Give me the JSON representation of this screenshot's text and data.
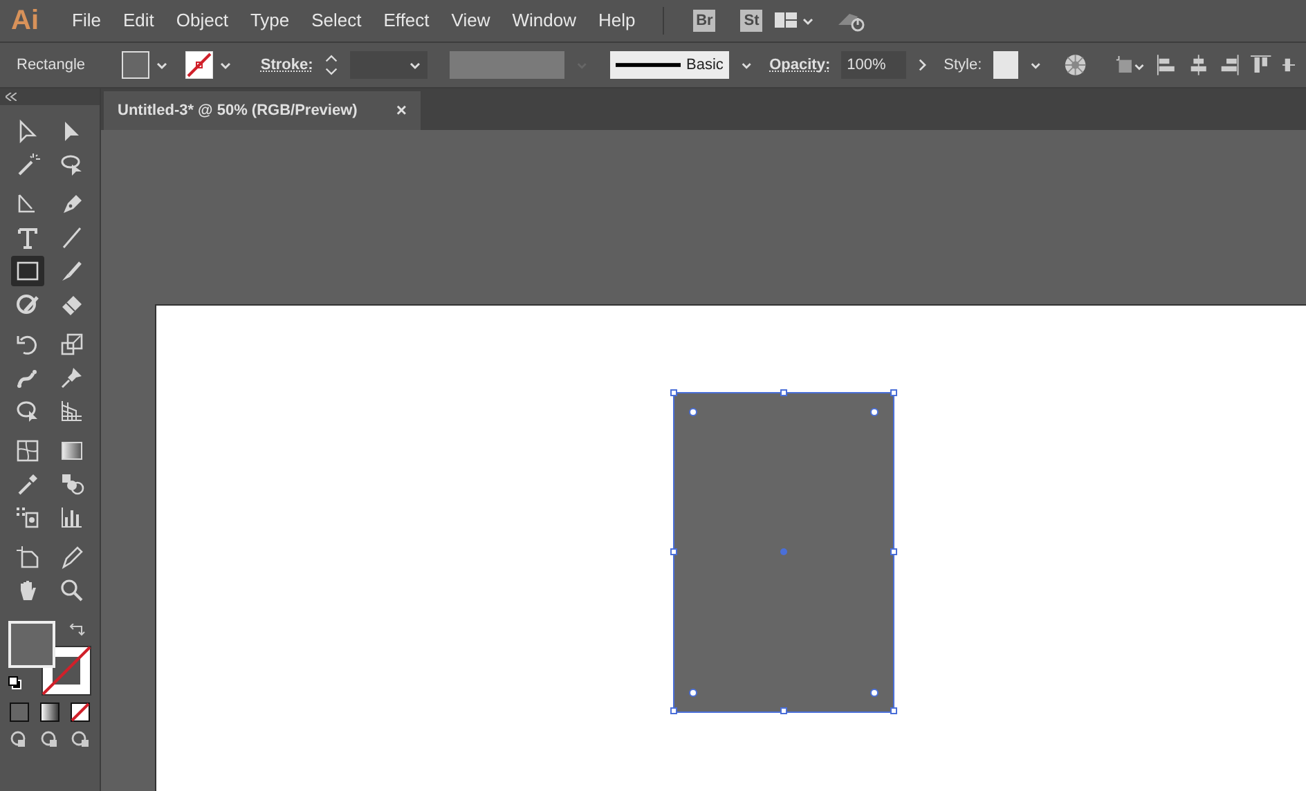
{
  "app": {
    "logo": "Ai"
  },
  "menu": [
    "File",
    "Edit",
    "Object",
    "Type",
    "Select",
    "Effect",
    "View",
    "Window",
    "Help"
  ],
  "app_buttons": [
    "Br",
    "St"
  ],
  "control_bar": {
    "tool_name": "Rectangle",
    "stroke_label": "Stroke:",
    "brush": "Basic",
    "opacity_label": "Opacity:",
    "opacity": "100%",
    "style_label": "Style:"
  },
  "document_tab": {
    "title": "Untitled-3* @ 50% (RGB/Preview)",
    "close": "×"
  },
  "tool_groups": [
    [
      {
        "kind": "selection",
        "selected": false
      },
      {
        "kind": "direct",
        "selected": false
      },
      {
        "kind": "wand",
        "selected": false
      },
      {
        "kind": "lasso",
        "selected": false
      }
    ],
    [
      {
        "kind": "curvature",
        "selected": false
      },
      {
        "kind": "pen",
        "selected": false
      },
      {
        "kind": "type",
        "selected": false
      },
      {
        "kind": "line",
        "selected": false
      },
      {
        "kind": "rectangle",
        "selected": true
      },
      {
        "kind": "brush",
        "selected": false
      },
      {
        "kind": "shaper",
        "selected": false
      },
      {
        "kind": "eraser",
        "selected": false
      }
    ],
    [
      {
        "kind": "rotate",
        "selected": false
      },
      {
        "kind": "scale",
        "selected": false
      },
      {
        "kind": "puppet",
        "selected": false
      },
      {
        "kind": "pin",
        "selected": false
      },
      {
        "kind": "shapebuilder",
        "selected": false
      },
      {
        "kind": "perspective",
        "selected": false
      }
    ],
    [
      {
        "kind": "mesh",
        "selected": false
      },
      {
        "kind": "gradient",
        "selected": false
      },
      {
        "kind": "eyedropper",
        "selected": false
      },
      {
        "kind": "blend",
        "selected": false
      },
      {
        "kind": "sprayer",
        "selected": false
      },
      {
        "kind": "graph",
        "selected": false
      }
    ],
    [
      {
        "kind": "artboard",
        "selected": false
      },
      {
        "kind": "knife",
        "selected": false
      },
      {
        "kind": "hand",
        "selected": false
      },
      {
        "kind": "zoom",
        "selected": false
      }
    ]
  ]
}
